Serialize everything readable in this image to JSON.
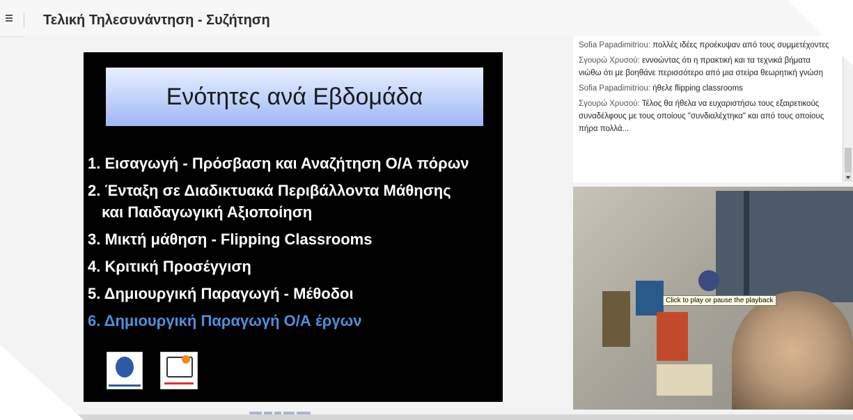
{
  "page": {
    "title": "Τελική Τηλεσυνάντηση - Συζήτηση"
  },
  "slide": {
    "title": "Ενότητες ανά Εβδομάδα",
    "items": [
      "1. Εισαγωγή - Πρόσβαση και Αναζήτηση Ο/Α πόρων",
      "2. Ένταξη σε Διαδικτυακά Περιβάλλοντα Μάθησης",
      "και Παιδαγωγική Αξιοποίηση",
      "3. Μικτή μάθηση - Flipping Classrooms",
      "4. Κριτική Προσέγγιση",
      "5. Δημιουργική Παραγωγή - Μέθοδοι",
      "6. Δημιουργική Παραγωγή Ο/Α έργων"
    ],
    "highlight_color": "#4f8fdc"
  },
  "chat": {
    "messages": [
      {
        "author": "Sofia Papadimitriou:",
        "text": "πολλές ιδέες προέκυψαν από τους συμμετέχοντες"
      },
      {
        "author": "Σγουρώ Χρυσού:",
        "text": "εννοώντας ότι η πρακτική και τα τεχνικά βήματα νιώθω ότι με βοηθάνε περισσότερο από μια στείρα θεωρητική γνώση"
      },
      {
        "author": "Sofia Papadimitriou:",
        "text": "ήθελε flipping classrooms"
      },
      {
        "author": "Σγουρώ Χρυσού:",
        "text": "Τέλος θα ήθελα να ευχαριστήσω τους εξαιρετικούς συναδέλφους με τους οποίους \"συνδιαλέχτηκα\" και από τους οποίους πήρα πολλά..."
      }
    ]
  },
  "video": {
    "tooltip": "Click to play or pause the playback"
  }
}
